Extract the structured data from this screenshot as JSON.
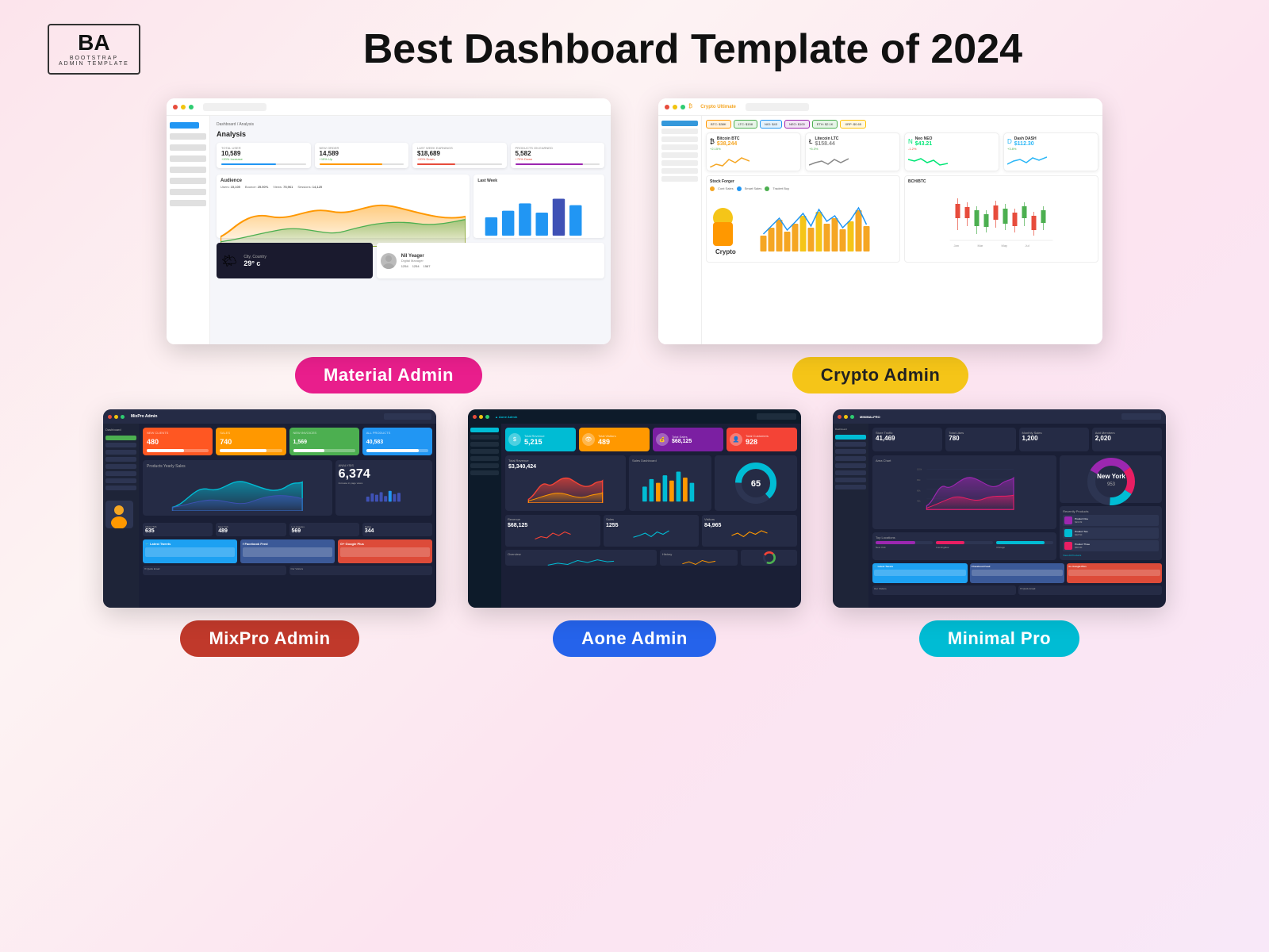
{
  "header": {
    "logo_letters": "BA",
    "logo_sub": "BOOTSTRAP\nADMIN TEMPLATE",
    "main_title": "Best Dashboard Template of 2024"
  },
  "dashboards": {
    "material": {
      "label": "Material  Admin",
      "badge_class": "badge-pink",
      "stats": [
        {
          "label": "TOTAL USER",
          "value": "10,589",
          "change": "+20% Increase in 24 Days"
        },
        {
          "label": "NEW ORDER",
          "value": "14,589",
          "change": "+15% Up"
        },
        {
          "label": "LAST WEEK EARNINGS",
          "value": "$18,689",
          "change": "+20% Down"
        },
        {
          "label": "PRODUCTS ON EARNED",
          "value": "5,582",
          "change": "+70% Down"
        }
      ],
      "audience": {
        "label": "Audience",
        "metrics": [
          {
            "label": "Users",
            "value": "15,105"
          },
          {
            "label": "Bounce Rate",
            "value": "25.50%"
          },
          {
            "label": "Page Views",
            "value": "75,961"
          },
          {
            "label": "Sessions",
            "value": "14,125"
          }
        ]
      },
      "weather": {
        "city": "City, Country",
        "temp": "29° c"
      },
      "profile": {
        "name": "Nil Yeager",
        "title": "Digital Manager",
        "stats": [
          "1254",
          "1254",
          "1587"
        ]
      }
    },
    "crypto": {
      "label": "Crypto Admin",
      "badge_class": "badge-yellow",
      "coins": [
        {
          "name": "Bitcoin BTC",
          "price": "$38,244",
          "change": "+2.15%",
          "color": "#f5a623"
        },
        {
          "name": "Litecoin LTC",
          "price": "$158.44",
          "change": "+5.3%",
          "color": "#888"
        },
        {
          "name": "Neo NEO",
          "price": "$43.21",
          "change": "-1.2%",
          "color": "#00e676"
        },
        {
          "name": "Dash DASH",
          "price": "$112.30",
          "change": "+3.8%",
          "color": "#29b6f6"
        }
      ],
      "charts": [
        {
          "title": "Stock Forger"
        },
        {
          "title": "BCH/BTC"
        }
      ]
    },
    "mixpro": {
      "label": "MixPro Admin",
      "badge_class": "badge-red",
      "stats": [
        {
          "label": "NEW CLIENTS",
          "value": "480",
          "color": "#ff5722"
        },
        {
          "label": "",
          "value": "740",
          "color": "#ff9800"
        },
        {
          "label": "NEW INVOICES",
          "value": "1,569",
          "color": "#4caf50"
        },
        {
          "label": "ALL PRODUCTS",
          "value": "40,583",
          "color": "#2196f3"
        }
      ],
      "chart_title": "Products Yearly Sales",
      "analysis_value": "6,374"
    },
    "aone": {
      "label": "Aone  Admin",
      "badge_class": "badge-blue",
      "stats": [
        {
          "label": "Total Revenue",
          "value": "5,215",
          "color": "#00bcd4"
        },
        {
          "label": "Total Visitors",
          "value": "489",
          "color": "#ff9800"
        },
        {
          "label": "Total Sales",
          "value": "$68,125",
          "color": "#9c27b0"
        },
        {
          "label": "Total Customers",
          "value": "928",
          "color": "#f44336"
        }
      ],
      "total_revenue": "$3,340,424",
      "gauge_value": "65"
    },
    "minimal": {
      "label": "Minimal Pro",
      "badge_class": "badge-cyan",
      "stats": [
        {
          "label": "Store Traffic",
          "value": "41,469"
        },
        {
          "label": "Total Likes",
          "value": "780"
        },
        {
          "label": "Monthly Sales",
          "value": "1,200"
        },
        {
          "label": "Add Members",
          "value": "2,020"
        }
      ],
      "chart_title": "Area Chart",
      "top_locations": "Top Locations",
      "donut_label": "New York",
      "donut_value": "953",
      "recently_products": "Recently Products"
    }
  }
}
